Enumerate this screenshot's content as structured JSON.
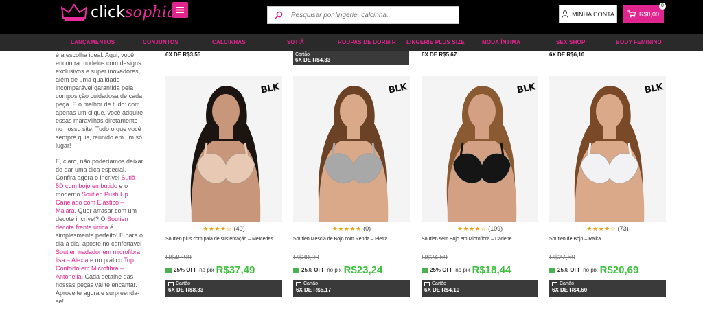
{
  "header": {
    "logo_text_1": "click",
    "logo_text_2": "sophia",
    "search_placeholder": "Pesquisar por lingerie, calcinha...",
    "account_label": "MINHA CONTA",
    "cart_total": "R$0,00",
    "cart_count": "0"
  },
  "nav": [
    "LANÇAMENTOS",
    "CONJUNTOS",
    "CALCINHAS",
    "SUTIÃ",
    "ROUPAS DE DORMIR",
    "LINGERIE PLUS SIZE",
    "MODA ÍNTIMA",
    "SEX SHOP",
    "BODY FEMININO"
  ],
  "sidebar": {
    "p1": "é a escolha ideal. Aqui, você encontra modelos com designs exclusivos e super inovadores, além de uma qualidade incomparável garantida pela composição cuidadosa de cada peça. E o melhor de tudo: com apenas um clique, você adquire essas maravilhas diretamente no nosso site. Tudo o que você sempre quis, reunido em um só lugar!",
    "p2_a": "E, claro, não poderíamos deixar de dar uma dica especial. Confira agora o incrível ",
    "link1": "Sutiã 5D com bojo embutido",
    "p2_b": " e o moderno ",
    "link2": "Soutien Push Up Canelado com Elástico – Maiara",
    "p2_c": ". Quer arrasar com um decote incrível? O ",
    "link3": "Soutien decote frente única",
    "p2_d": " é simplesmente perfeito! E para o dia a dia, aposte no confortável ",
    "link4": "Soutien nadador em microfibra lisa – Alexia",
    "p2_e": " e no prático ",
    "link5": "Top Conforto em Microfibra – Antonella",
    "p2_f": ". Cada detalhe das nossas peças vai te encantar. Aproveite agora e surpreenda-se!"
  },
  "previous_row": {
    "col1": "6X DE R$3,55",
    "col2_card": "Cartão",
    "col2": "6X DE R$4,33",
    "col3": "6X DE R$5,67",
    "col4": "6X DE R$6,10"
  },
  "badge": "BLK",
  "card_label": "Cartão",
  "off_label": "25% OFF",
  "nopix_label": "no pix",
  "products": [
    {
      "stars": "★★★★☆",
      "reviews": "(40)",
      "name": "Soutien plus com pala de sustentação – Mercedes",
      "old_price": "R$49,99",
      "pix_price": "R$37,49",
      "installments": "6X DE R$8,33",
      "skin": "#c8967a",
      "garment": "#e8c9b4",
      "hair": "#1c1410"
    },
    {
      "stars": "★★★★★",
      "reviews": "(0)",
      "name": "Soutien Mescla de Bojo com Renda – Pietra",
      "old_price": "R$30,99",
      "pix_price": "R$23,24",
      "installments": "6X DE R$5,17",
      "skin": "#d9a989",
      "garment": "#a8a8a8",
      "hair": "#6b4226"
    },
    {
      "stars": "★★★★☆",
      "reviews": "(109)",
      "name": "Soutien sem Bojo em Microfibra – Darlene",
      "old_price": "R$24,59",
      "pix_price": "R$18,44",
      "installments": "6X DE R$4,10",
      "skin": "#d4a083",
      "garment": "#151515",
      "hair": "#8a5a33"
    },
    {
      "stars": "★★★★☆",
      "reviews": "(73)",
      "name": "Soutien de Bojo – Raika",
      "old_price": "R$27,59",
      "pix_price": "R$20,69",
      "installments": "6X DE R$4,60",
      "skin": "#d9a98a",
      "garment": "#f2f2f4",
      "hair": "#7a4a28"
    }
  ]
}
